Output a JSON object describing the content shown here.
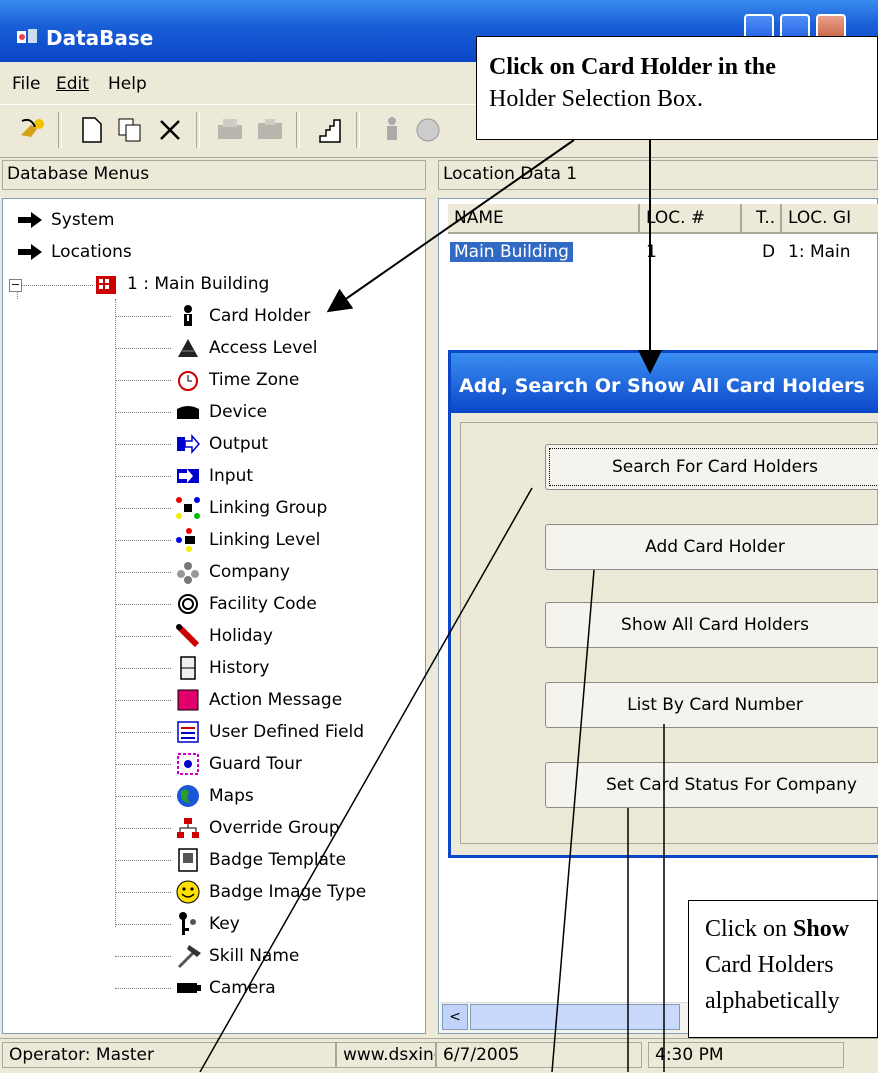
{
  "window": {
    "title": "DataBase"
  },
  "menu": {
    "items": [
      "File",
      "Edit",
      "Help"
    ]
  },
  "left_pane": {
    "header": "Database Menus",
    "tree": {
      "system": "System",
      "locations": "Locations",
      "location_node": "1 : Main Building",
      "children": [
        "Card Holder",
        "Access Level",
        "Time Zone",
        "Device",
        "Output",
        "Input",
        "Linking Group",
        "Linking Level",
        "Company",
        "Facility Code",
        "Holiday",
        "History",
        "Action Message",
        "User Defined Field",
        "Guard Tour",
        "Maps",
        "Override Group",
        "Badge Template",
        "Badge Image Type",
        "Key",
        "Skill Name",
        "Camera"
      ]
    }
  },
  "right_pane": {
    "header": "Location Data   1",
    "columns": [
      "NAME",
      "LOC. #",
      "T..",
      "LOC. GI"
    ],
    "row": {
      "name": "Main Building",
      "loc": "1",
      "t": "D",
      "group": "1: Main"
    }
  },
  "dialog": {
    "title": "Add, Search Or Show All Card Holders",
    "buttons": [
      "Search For Card Holders",
      "Add Card Holder",
      "Show All Card Holders",
      "List By Card Number",
      "Set Card Status For Company"
    ]
  },
  "statusbar": {
    "operator": "Operator:  Master",
    "site": "www.dsxinc",
    "date": "6/7/2005",
    "time": "4:30 PM"
  },
  "callouts": {
    "top_bold": "Click on Card Holder in the",
    "top_rest": "Holder Selection Box.",
    "bottom_line1_a": "Click on ",
    "bottom_line1_b": "Show",
    "bottom_line2": "Card Holders",
    "bottom_line3": "alphabetically"
  },
  "colors": {
    "titlebar": "#0a46c8",
    "selection": "#316ac5",
    "face": "#ece9d8"
  }
}
